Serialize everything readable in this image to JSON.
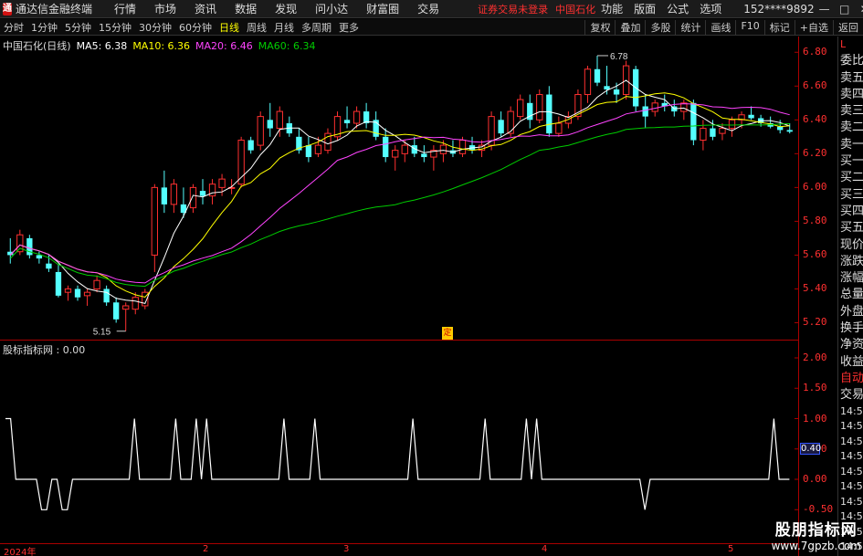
{
  "menubar": {
    "app_name": "通达信金融终端",
    "items": [
      "行情",
      "市场",
      "资讯",
      "数据",
      "发现",
      "问小达",
      "财富圈",
      "交易"
    ],
    "notice": "证券交易未登录",
    "stock_name": "中国石化",
    "right_items": [
      "功能",
      "版面",
      "公式",
      "选项"
    ],
    "user": "152****9892",
    "window_controls": [
      "—",
      "□",
      "✕"
    ]
  },
  "toolbar": {
    "periods": [
      "分时",
      "1分钟",
      "5分钟",
      "15分钟",
      "30分钟",
      "60分钟",
      "日线",
      "周线",
      "月线",
      "多周期",
      "更多"
    ],
    "active_period": "日线",
    "right_buttons": [
      "复权",
      "叠加",
      "多股",
      "统计",
      "画线",
      "F10",
      "标记",
      "+自选",
      "返回"
    ]
  },
  "legend": {
    "stock": "中国石化(日线)",
    "ma5": "MA5: 6.38",
    "ma10": "MA10: 6.36",
    "ma20": "MA20: 6.46",
    "ma60": "MA60: 6.34"
  },
  "indicator_legend": "股标指标网 : 0.00",
  "price_axis": [
    "6.80",
    "6.60",
    "6.40",
    "6.20",
    "6.00",
    "5.80",
    "5.60",
    "5.40",
    "5.20"
  ],
  "indicator_axis": [
    "2.00",
    "1.50",
    "1.00",
    "0.50",
    "0.00",
    "-0.50"
  ],
  "indicator_value_box": "0.40",
  "high_label": "6.78",
  "low_label": "5.15",
  "date_labels": [
    "2024年",
    "2",
    "3",
    "4",
    "5"
  ],
  "side_panel": [
    "委比",
    "卖五",
    "卖四",
    "卖三",
    "卖二",
    "卖一",
    "买一",
    "买二",
    "买三",
    "买四",
    "买五",
    "现价",
    "涨跌",
    "涨幅",
    "总量",
    "外盘",
    "换手",
    "净资",
    "收益"
  ],
  "side_panel2": [
    "自动",
    "交易"
  ],
  "time_items": [
    "14:56",
    "14:56",
    "14:56",
    "14:56",
    "14:56",
    "14:56",
    "14:56",
    "14:56",
    "14:56",
    "14:56"
  ],
  "marker": "定",
  "watermark": {
    "line1": "股朋指标网",
    "line2": "www.7gpzb.com"
  },
  "colors": {
    "up": "#ff3030",
    "down": "#54ffff",
    "ma5": "#ffffff",
    "ma10": "#ffff00",
    "ma20": "#ff44ff",
    "ma60": "#00cc00"
  },
  "chart_data": {
    "type": "candlestick",
    "price_range": [
      5.1,
      6.85
    ],
    "candles": [
      [
        5.62,
        5.7,
        5.55,
        5.6
      ],
      [
        5.62,
        5.75,
        5.6,
        5.72
      ],
      [
        5.7,
        5.72,
        5.58,
        5.6
      ],
      [
        5.6,
        5.62,
        5.55,
        5.58
      ],
      [
        5.55,
        5.6,
        5.5,
        5.52
      ],
      [
        5.5,
        5.55,
        5.35,
        5.36
      ],
      [
        5.38,
        5.42,
        5.33,
        5.4
      ],
      [
        5.4,
        5.42,
        5.33,
        5.35
      ],
      [
        5.36,
        5.4,
        5.3,
        5.38
      ],
      [
        5.4,
        5.48,
        5.38,
        5.45
      ],
      [
        5.4,
        5.42,
        5.3,
        5.32
      ],
      [
        5.32,
        5.35,
        5.2,
        5.22
      ],
      [
        5.28,
        5.32,
        5.15,
        5.3
      ],
      [
        5.28,
        5.38,
        5.25,
        5.35
      ],
      [
        5.3,
        5.4,
        5.28,
        5.38
      ],
      [
        5.6,
        6.02,
        5.5,
        6.0
      ],
      [
        6.0,
        6.1,
        5.85,
        5.9
      ],
      [
        5.9,
        6.05,
        5.85,
        6.02
      ],
      [
        5.9,
        6.0,
        5.82,
        5.85
      ],
      [
        5.88,
        6.02,
        5.85,
        6.0
      ],
      [
        5.98,
        6.05,
        5.9,
        5.95
      ],
      [
        5.95,
        6.05,
        5.9,
        6.02
      ],
      [
        6.0,
        6.08,
        5.95,
        6.05
      ],
      [
        6.0,
        6.05,
        5.96,
        6.0
      ],
      [
        6.02,
        6.3,
        6.0,
        6.28
      ],
      [
        6.28,
        6.3,
        6.2,
        6.22
      ],
      [
        6.25,
        6.45,
        6.22,
        6.42
      ],
      [
        6.4,
        6.5,
        6.3,
        6.35
      ],
      [
        6.35,
        6.48,
        6.3,
        6.45
      ],
      [
        6.38,
        6.42,
        6.3,
        6.32
      ],
      [
        6.3,
        6.35,
        6.2,
        6.22
      ],
      [
        6.25,
        6.3,
        6.15,
        6.18
      ],
      [
        6.2,
        6.3,
        6.18,
        6.25
      ],
      [
        6.22,
        6.35,
        6.2,
        6.32
      ],
      [
        6.3,
        6.45,
        6.28,
        6.42
      ],
      [
        6.4,
        6.48,
        6.35,
        6.38
      ],
      [
        6.38,
        6.48,
        6.35,
        6.45
      ],
      [
        6.45,
        6.5,
        6.35,
        6.38
      ],
      [
        6.4,
        6.45,
        6.28,
        6.3
      ],
      [
        6.3,
        6.35,
        6.15,
        6.18
      ],
      [
        6.18,
        6.25,
        6.1,
        6.22
      ],
      [
        6.2,
        6.28,
        6.15,
        6.25
      ],
      [
        6.25,
        6.3,
        6.18,
        6.2
      ],
      [
        6.2,
        6.25,
        6.15,
        6.18
      ],
      [
        6.18,
        6.25,
        6.1,
        6.22
      ],
      [
        6.2,
        6.28,
        6.15,
        6.25
      ],
      [
        6.22,
        6.28,
        6.18,
        6.2
      ],
      [
        6.2,
        6.3,
        6.18,
        6.28
      ],
      [
        6.25,
        6.3,
        6.2,
        6.22
      ],
      [
        6.22,
        6.28,
        6.18,
        6.25
      ],
      [
        6.25,
        6.45,
        6.22,
        6.42
      ],
      [
        6.4,
        6.45,
        6.3,
        6.32
      ],
      [
        6.32,
        6.48,
        6.3,
        6.45
      ],
      [
        6.42,
        6.55,
        6.4,
        6.52
      ],
      [
        6.5,
        6.55,
        6.35,
        6.4
      ],
      [
        6.4,
        6.58,
        6.38,
        6.55
      ],
      [
        6.55,
        6.6,
        6.3,
        6.32
      ],
      [
        6.32,
        6.42,
        6.3,
        6.38
      ],
      [
        6.38,
        6.45,
        6.35,
        6.42
      ],
      [
        6.42,
        6.58,
        6.4,
        6.55
      ],
      [
        6.55,
        6.72,
        6.5,
        6.7
      ],
      [
        6.7,
        6.78,
        6.6,
        6.62
      ],
      [
        6.6,
        6.72,
        6.55,
        6.58
      ],
      [
        6.58,
        6.62,
        6.5,
        6.55
      ],
      [
        6.55,
        6.75,
        6.52,
        6.72
      ],
      [
        6.7,
        6.72,
        6.45,
        6.48
      ],
      [
        6.48,
        6.55,
        6.35,
        6.42
      ],
      [
        6.45,
        6.52,
        6.42,
        6.5
      ],
      [
        6.5,
        6.55,
        6.45,
        6.48
      ],
      [
        6.48,
        6.52,
        6.42,
        6.45
      ],
      [
        6.45,
        6.52,
        6.4,
        6.5
      ],
      [
        6.5,
        6.52,
        6.25,
        6.28
      ],
      [
        6.28,
        6.4,
        6.22,
        6.35
      ],
      [
        6.35,
        6.4,
        6.28,
        6.3
      ],
      [
        6.32,
        6.38,
        6.28,
        6.35
      ],
      [
        6.35,
        6.42,
        6.3,
        6.4
      ],
      [
        6.4,
        6.45,
        6.35,
        6.43
      ],
      [
        6.43,
        6.48,
        6.4,
        6.41
      ],
      [
        6.41,
        6.43,
        6.36,
        6.38
      ],
      [
        6.38,
        6.42,
        6.35,
        6.36
      ],
      [
        6.36,
        6.4,
        6.32,
        6.34
      ],
      [
        6.34,
        6.38,
        6.32,
        6.33
      ]
    ],
    "indicator": [
      1,
      1,
      0,
      0,
      0,
      0,
      0,
      -1,
      -1,
      0,
      0,
      -1,
      -1,
      0,
      0,
      0,
      0,
      0,
      0,
      0,
      0,
      0,
      0,
      0,
      0,
      1,
      0,
      0,
      0,
      0,
      0,
      0,
      0,
      1,
      0,
      0,
      0,
      1,
      0,
      1,
      0,
      0,
      0,
      0,
      0,
      0,
      0,
      0,
      0,
      0,
      0,
      0,
      0,
      0,
      1,
      0,
      0,
      0,
      0,
      0,
      1,
      0,
      0,
      0,
      0,
      0,
      0,
      0,
      0,
      0,
      0,
      0,
      0,
      0,
      0,
      0,
      0,
      0,
      0,
      1,
      0,
      0,
      0,
      0,
      0,
      0,
      0,
      0,
      0,
      0,
      0,
      0,
      0,
      1,
      0,
      0,
      0,
      0,
      0,
      0,
      0,
      1,
      0,
      1,
      0,
      0,
      0,
      0,
      0,
      0,
      0,
      0,
      0,
      0,
      0,
      0,
      0,
      0,
      0,
      0,
      0,
      0,
      0,
      0,
      -1,
      0,
      0,
      0,
      0,
      0,
      0,
      0,
      0,
      0,
      0,
      0,
      0,
      0,
      0,
      0,
      0,
      0,
      0,
      0,
      0,
      0,
      0,
      0,
      0,
      1,
      0,
      0,
      0
    ]
  }
}
